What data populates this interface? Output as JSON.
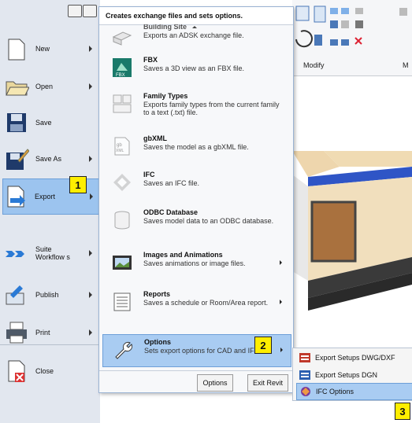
{
  "left_menu": {
    "items": [
      {
        "label": "New",
        "has_arrow": true
      },
      {
        "label": "Open",
        "has_arrow": true
      },
      {
        "label": "Save",
        "has_arrow": false
      },
      {
        "label": "Save As",
        "has_arrow": true
      },
      {
        "label": "Export",
        "has_arrow": true,
        "active": true
      },
      {
        "label": "Suite Workflow s",
        "has_arrow": true
      },
      {
        "label": "Publish",
        "has_arrow": true
      },
      {
        "label": "Print",
        "has_arrow": true
      },
      {
        "label": "Close",
        "has_arrow": false
      }
    ]
  },
  "submenu": {
    "header": "Creates exchange files and sets options.",
    "items": [
      {
        "title": "Building Site",
        "desc": "Exports an ADSK exchange file.",
        "icon": "building-site-icon"
      },
      {
        "title": "FBX",
        "desc": "Saves a 3D view as an FBX file.",
        "icon": "fbx-icon"
      },
      {
        "title": "Family Types",
        "desc": "Exports family types from the current family to a text (.txt) file.",
        "icon": "family-types-icon"
      },
      {
        "title": "gbXML",
        "desc": "Saves the model as a gbXML file.",
        "icon": "gbxml-icon"
      },
      {
        "title": "IFC",
        "desc": "Saves an IFC file.",
        "icon": "ifc-icon"
      },
      {
        "title": "ODBC Database",
        "desc": "Saves model data to an ODBC database.",
        "icon": "database-icon"
      },
      {
        "title": "Images and Animations",
        "desc": "Saves animations or image files.",
        "icon": "film-icon"
      },
      {
        "title": "Reports",
        "desc": "Saves a schedule or Room/Area report.",
        "icon": "report-icon"
      },
      {
        "title": "Options",
        "desc": "Sets export options for CAD and IFC.",
        "icon": "wrench-icon"
      }
    ],
    "options_button": "Options",
    "exit_button": "Exit Revit"
  },
  "flyout": {
    "items": [
      {
        "label": "Export Setups DWG/DXF",
        "icon": "dwg-setup-icon"
      },
      {
        "label": "Export Setups DGN",
        "icon": "dgn-setup-icon"
      },
      {
        "label": "IFC Options",
        "icon": "ifc-options-icon"
      }
    ]
  },
  "ribbon": {
    "panel_label": "Modify",
    "cut_label": "M"
  },
  "badges": [
    "1",
    "2",
    "3"
  ],
  "colors": {
    "active_fill": "#a9ccf2",
    "badge": "#ffee00",
    "menu_bg": "#e2e7ef"
  }
}
